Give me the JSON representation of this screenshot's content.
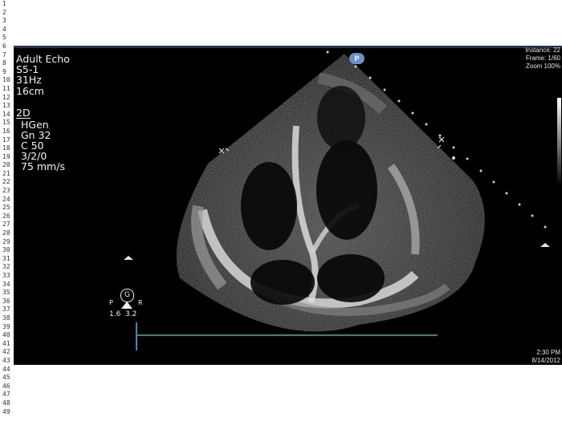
{
  "line_numbers": [
    "1",
    "2",
    "3",
    "4",
    "5",
    "6",
    "7",
    "8",
    "9",
    "10",
    "11",
    "12",
    "13",
    "14",
    "15",
    "16",
    "17",
    "18",
    "19",
    "20",
    "21",
    "22",
    "23",
    "24",
    "25",
    "26",
    "27",
    "28",
    "29",
    "30",
    "31",
    "32",
    "33",
    "34",
    "35",
    "36",
    "37",
    "38",
    "39",
    "40",
    "41",
    "42",
    "43",
    "44",
    "45",
    "46",
    "47",
    "48",
    "49"
  ],
  "left_panel": {
    "mode": "Adult Echo",
    "probe": "S5-1",
    "frame_rate": "31Hz",
    "depth": "16cm",
    "imaging_mode": "2D",
    "preset": "HGen",
    "gain": "Gn 32",
    "compression": "C 50",
    "persistence": "3/2/0",
    "sweep_speed": "75 mm/s"
  },
  "right_panel": {
    "instance": "Instance: 22",
    "frame": "Frame: 1/60",
    "zoom": "Zoom 100%",
    "time": "2:30 PM",
    "date": "8/14/2012"
  },
  "probe_marker": "P",
  "orientation": {
    "badge": "G",
    "left_label": "P",
    "right_label": "R",
    "values": "1.6  3.2"
  },
  "colors": {
    "viewport_bg": "#000000",
    "top_strip": "#23344a",
    "probe_marker": "#6f8fc8",
    "ecg_trace": "#2f8f4f",
    "overlay_text": "#f2f2f2"
  }
}
